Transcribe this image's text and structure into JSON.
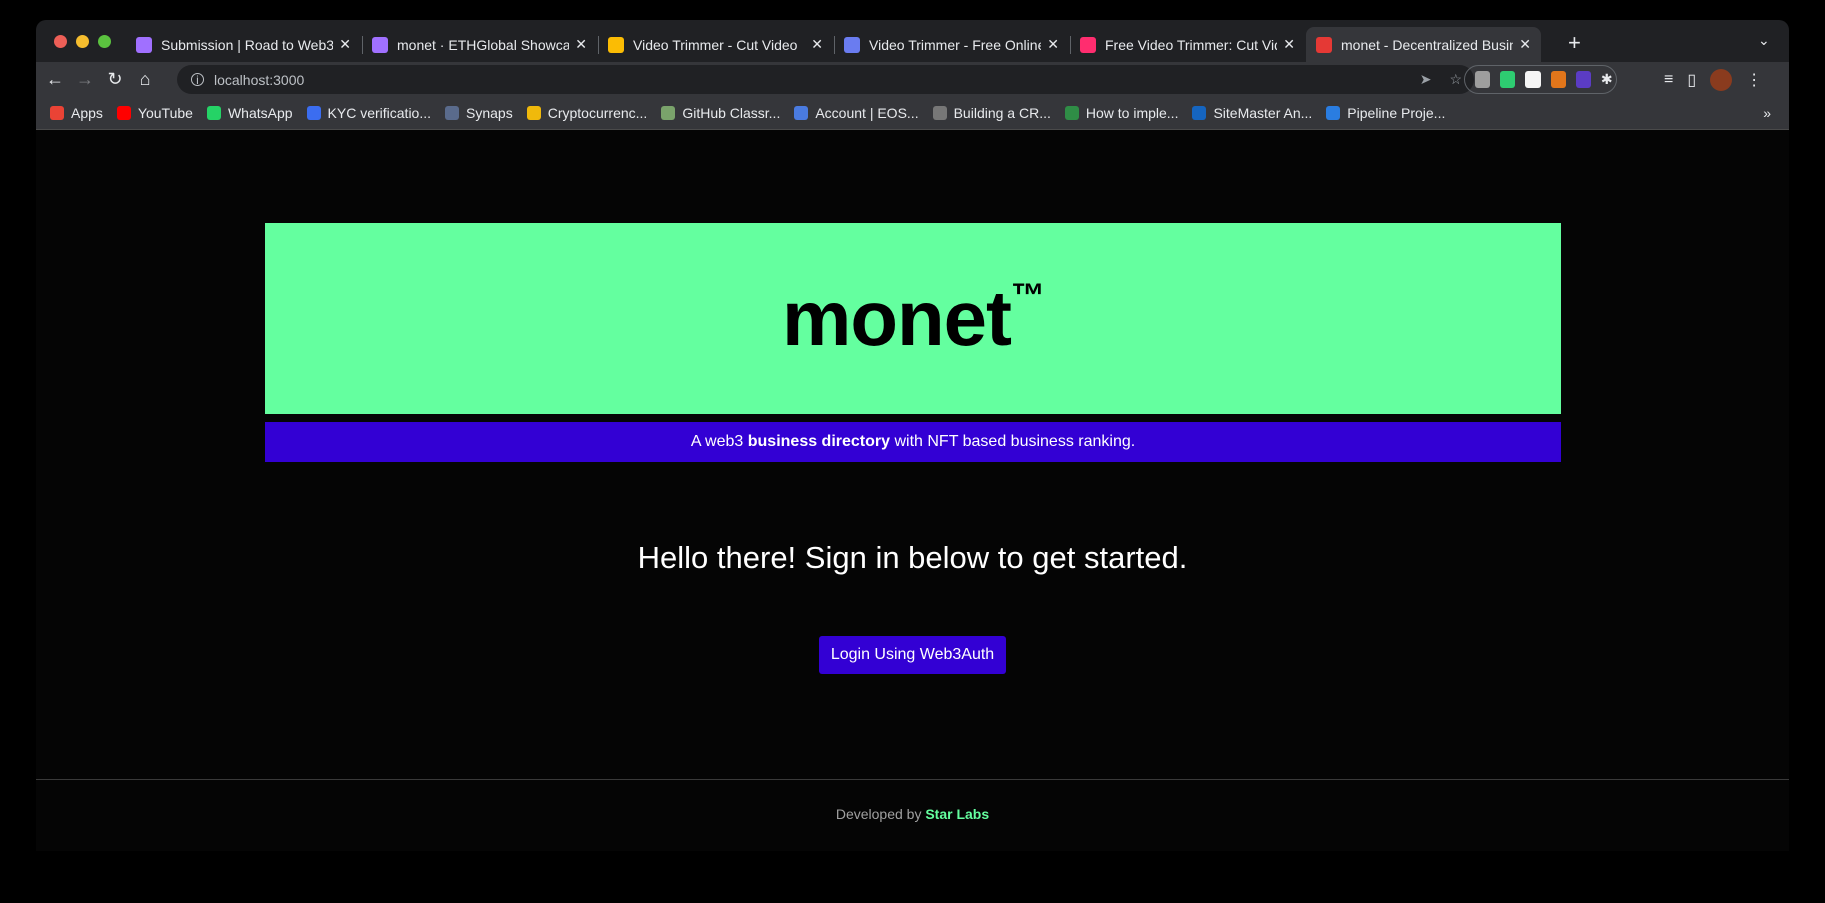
{
  "browser": {
    "tabs": [
      {
        "title": "Submission | Road to Web3",
        "favicon": "#a070ff"
      },
      {
        "title": "monet · ETHGlobal Showcase",
        "favicon": "#a070ff"
      },
      {
        "title": "Video Trimmer - Cut Video",
        "favicon": "#fbbc04"
      },
      {
        "title": "Video Trimmer - Free Online",
        "favicon": "#6a7cf0"
      },
      {
        "title": "Free Video Trimmer: Cut Video",
        "favicon": "#ff2d6f"
      },
      {
        "title": "monet - Decentralized Business",
        "favicon": "#e53935",
        "active": true
      }
    ],
    "new_tab": "+",
    "tab_menu": "⌄",
    "url": "localhost:3000",
    "bookmarks": [
      {
        "label": "Apps",
        "color": "#ea4335"
      },
      {
        "label": "YouTube",
        "color": "#ff0000"
      },
      {
        "label": "WhatsApp",
        "color": "#25d366"
      },
      {
        "label": "KYC verificatio...",
        "color": "#3b6df0"
      },
      {
        "label": "Synaps",
        "color": "#5a6b8c"
      },
      {
        "label": "Cryptocurrenc...",
        "color": "#f0b90b"
      },
      {
        "label": "GitHub Classr...",
        "color": "#7aa36b"
      },
      {
        "label": "Account | EOS...",
        "color": "#4a7be0"
      },
      {
        "label": "Building a CR...",
        "color": "#777"
      },
      {
        "label": "How to imple...",
        "color": "#2f8d46"
      },
      {
        "label": "SiteMaster An...",
        "color": "#1565c0"
      },
      {
        "label": "Pipeline Proje...",
        "color": "#2a7de1"
      }
    ],
    "bookmarks_more": "»"
  },
  "page": {
    "brand": "monet",
    "trademark": "™",
    "tagline_pre": "A web3 ",
    "tagline_bold": "business directory",
    "tagline_post": " with NFT based business ranking.",
    "greeting": "Hello there! Sign in below to get started.",
    "login_label": "Login Using Web3Auth",
    "footer_pre": "Developed by ",
    "footer_link": "Star Labs",
    "colors": {
      "hero": "#64ff9f",
      "accent": "#3300d4"
    }
  }
}
